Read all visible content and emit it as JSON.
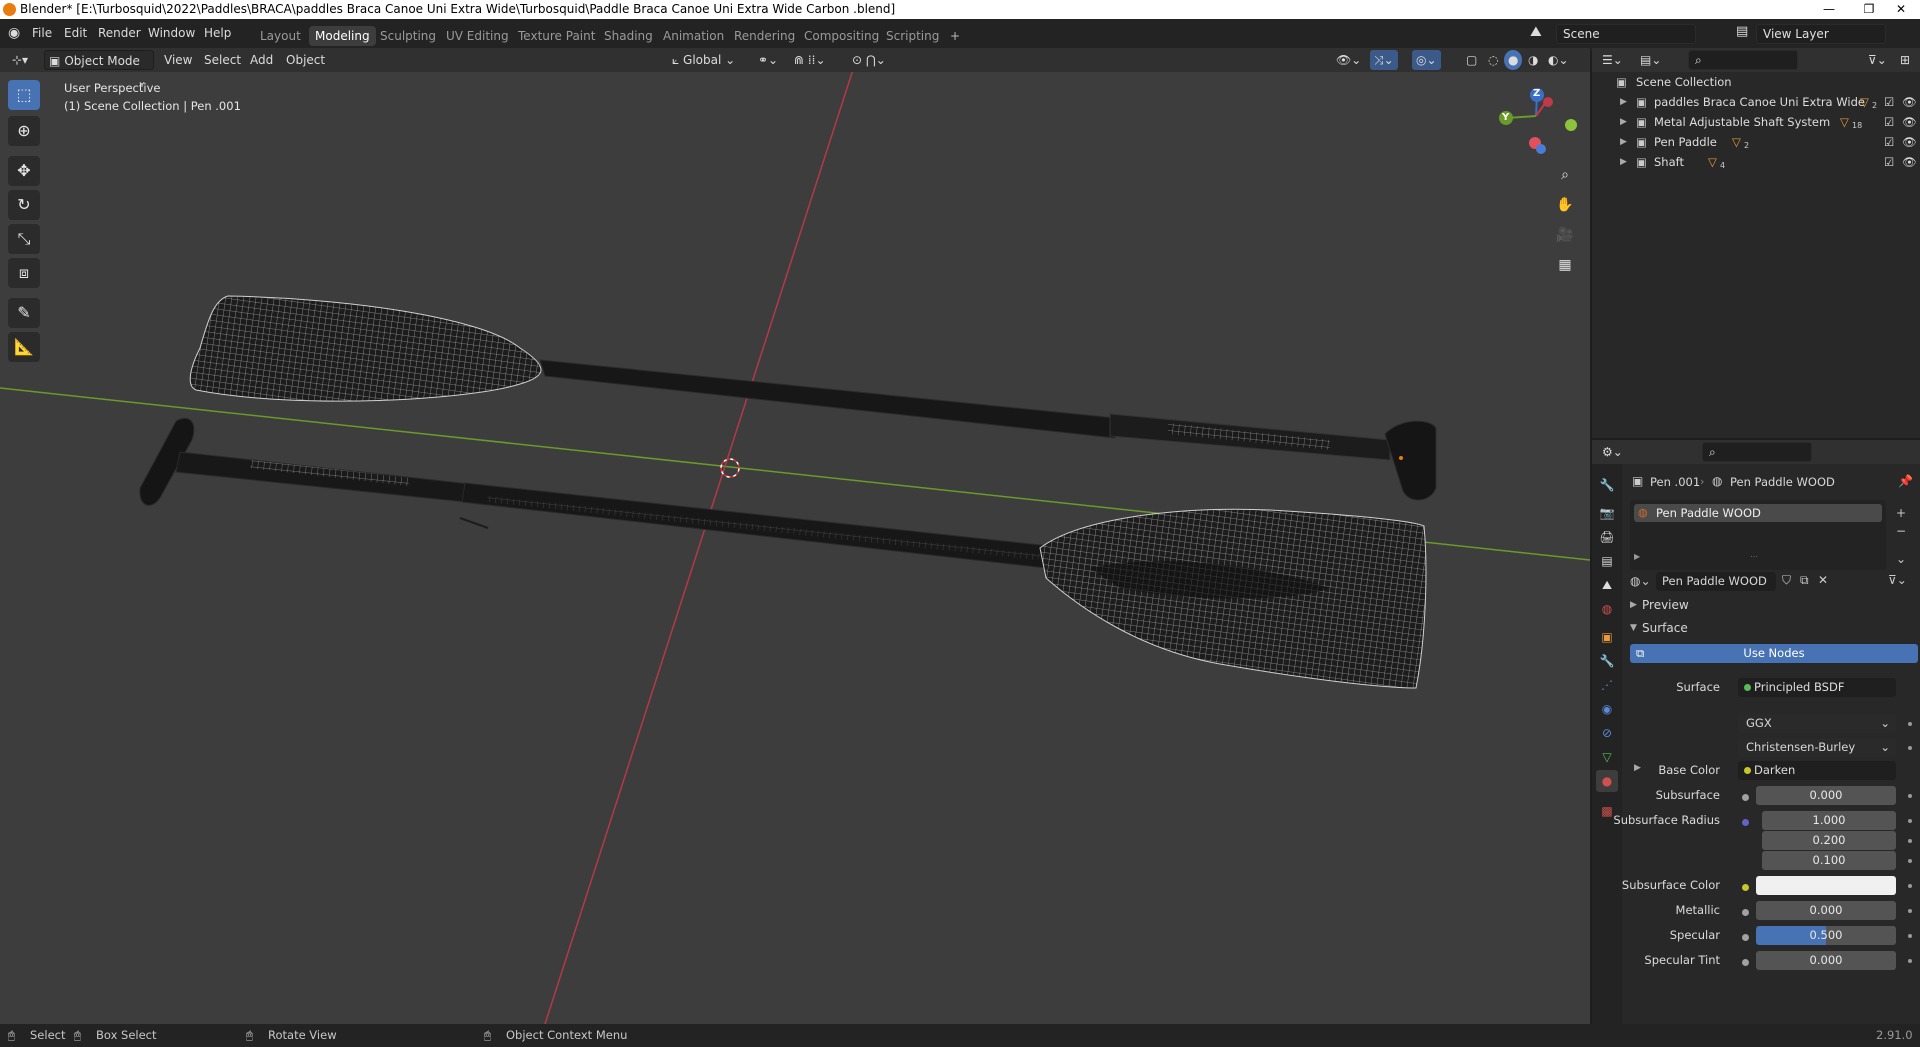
{
  "window": {
    "title": "Blender* [E:\\Turbosquid\\2022\\Paddles\\BRACA\\paddles Braca Canoe Uni Extra Wide\\Turbosquid\\Paddle Braca Canoe Uni Extra Wide  Carbon .blend]",
    "minimize": "—",
    "maximize": "❐",
    "close": "✕"
  },
  "menu": {
    "file": "File",
    "edit": "Edit",
    "render": "Render",
    "window": "Window",
    "help": "Help"
  },
  "workspaces": [
    "Layout",
    "Modeling",
    "Sculpting",
    "UV Editing",
    "Texture Paint",
    "Shading",
    "Animation",
    "Rendering",
    "Compositing",
    "Scripting",
    "+"
  ],
  "active_workspace": "Modeling",
  "scene": {
    "label": "Scene",
    "view_layer": "View Layer"
  },
  "viewport_header": {
    "mode": "Object Mode",
    "view": "View",
    "select": "Select",
    "add": "Add",
    "object": "Object",
    "orientation": "Global"
  },
  "viewport": {
    "perspective": "User Perspective",
    "collection_info": "(1) Scene Collection | Pen .001",
    "gizmo": {
      "z": "Z",
      "y": "Y"
    }
  },
  "outliner": {
    "root": "Scene Collection",
    "items": [
      {
        "name": "paddles Braca Canoe Uni Extra Wide",
        "badge": "2"
      },
      {
        "name": "Metal Adjustable Shaft System",
        "badge": "18"
      },
      {
        "name": "Pen Paddle",
        "badge": "2"
      },
      {
        "name": "Shaft",
        "badge": "4"
      }
    ]
  },
  "properties": {
    "breadcrumb_object": "Pen .001",
    "breadcrumb_material": "Pen Paddle WOOD",
    "slot_material": "Pen Paddle WOOD",
    "material_name": "Pen Paddle WOOD",
    "preview_panel": "Preview",
    "surface_panel": "Surface",
    "use_nodes": "Use Nodes",
    "surface_label": "Surface",
    "surface_value": "Principled BSDF",
    "distribution": "GGX",
    "subsurface_method": "Christensen-Burley",
    "rows": [
      {
        "label": "Base Color",
        "value": "Darken",
        "kind": "link"
      },
      {
        "label": "Subsurface",
        "value": "0.000",
        "kind": "num"
      },
      {
        "label": "Subsurface Radius",
        "value": "1.000",
        "kind": "num"
      },
      {
        "label": "",
        "value": "0.200",
        "kind": "num"
      },
      {
        "label": "",
        "value": "0.100",
        "kind": "num"
      },
      {
        "label": "Subsurface Color",
        "value": "",
        "kind": "color"
      },
      {
        "label": "Metallic",
        "value": "0.000",
        "kind": "num"
      },
      {
        "label": "Specular",
        "value": "0.500",
        "kind": "num",
        "fill": 0.5
      },
      {
        "label": "Specular Tint",
        "value": "0.000",
        "kind": "num"
      }
    ]
  },
  "statusbar": {
    "select": "Select",
    "box_select": "Box Select",
    "rotate_view": "Rotate View",
    "context_menu": "Object Context Menu",
    "version": "2.91.0"
  },
  "colors": {
    "accent": "#4772b3",
    "viewport_bg": "#3d3d3d",
    "x_axis": "#b23a48",
    "y_axis": "#6a9a2a",
    "orange": "#e87d0d"
  }
}
